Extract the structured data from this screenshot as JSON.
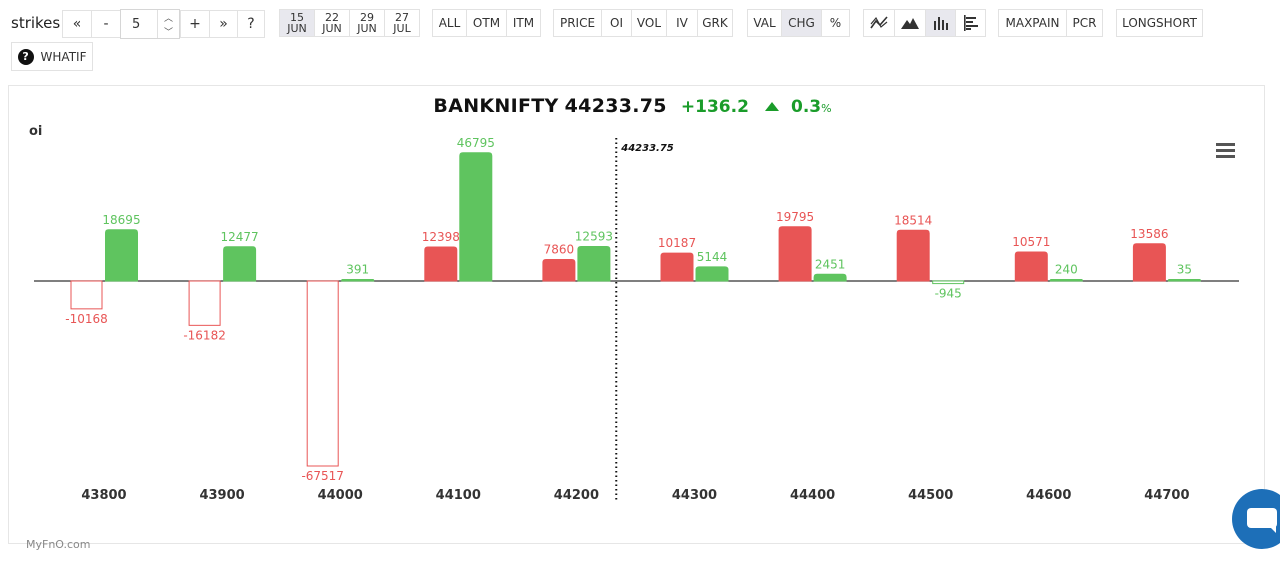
{
  "toolbar": {
    "strikes_label": "strikes:",
    "first_label": "«",
    "minus_label": "-",
    "strikes_value": "5",
    "plus_label": "+",
    "last_label": "»",
    "help_label": "?",
    "expiries": [
      {
        "day": "15",
        "month": "JUN"
      },
      {
        "day": "22",
        "month": "JUN"
      },
      {
        "day": "29",
        "month": "JUN"
      },
      {
        "day": "27",
        "month": "JUL"
      }
    ],
    "filter_all": "ALL",
    "filter_otm": "OTM",
    "filter_itm": "ITM",
    "metric_price": "PRICE",
    "metric_oi": "OI",
    "metric_vol": "VOL",
    "metric_iv": "IV",
    "metric_grk": "GRK",
    "mode_val": "VAL",
    "mode_chg": "CHG",
    "mode_pct": "%",
    "maxpain": "MAXPAIN",
    "pcr": "PCR",
    "longshort": "LONGSHORT",
    "whatif": "WHATIF",
    "whatif_icon": "?"
  },
  "header": {
    "symbol": "BANKNIFTY",
    "price": "44233.75",
    "change": "+136.2",
    "change_pct": "0.3",
    "pct_sign": "%"
  },
  "credit": "MyFnO.com",
  "colors": {
    "call": "#e85555",
    "put": "#5fc45f",
    "up": "#1a9c2a"
  },
  "chart_data": {
    "type": "bar",
    "ylabel": "oi",
    "spot_label": "44233.75",
    "spot": 44233.75,
    "categories": [
      "43800",
      "43900",
      "44000",
      "44100",
      "44200",
      "44300",
      "44400",
      "44500",
      "44600",
      "44700"
    ],
    "series": [
      {
        "values": [
          -10168,
          -16182,
          -67517,
          12398,
          7860,
          10187,
          19795,
          18514,
          10571,
          13586
        ]
      },
      {
        "values": [
          18695,
          12477,
          391,
          46795,
          12593,
          5144,
          2451,
          -945,
          240,
          35
        ]
      }
    ]
  }
}
